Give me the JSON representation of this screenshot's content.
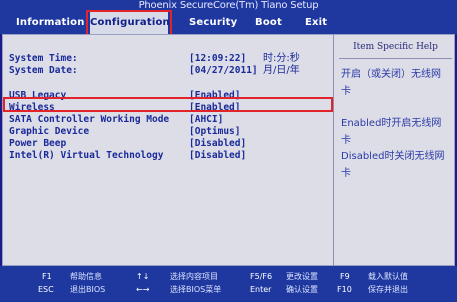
{
  "app_title": "Phoenix SecureCore(Tm) Tiano Setup",
  "menu": [
    {
      "label": "Information"
    },
    {
      "label": "Configuration"
    },
    {
      "label": "Security"
    },
    {
      "label": "Boot"
    },
    {
      "label": "Exit"
    }
  ],
  "settings": [
    {
      "label": "System Time:",
      "value": "[12:09:22]",
      "extra": "时:分:秒"
    },
    {
      "label": "System Date:",
      "value": "[04/27/2011]",
      "extra": "月/日/年"
    },
    {
      "label": "USB Legacy",
      "value": "[Enabled]"
    },
    {
      "label": "Wireless",
      "value": "[Enabled]"
    },
    {
      "label": "SATA Controller Working Mode",
      "value": "[AHCI]"
    },
    {
      "label": "Graphic Device",
      "value": "[Optimus]"
    },
    {
      "label": "Power Beep",
      "value": "[Disabled]"
    },
    {
      "label": "Intel(R) Virtual Technology",
      "value": "[Disabled]"
    }
  ],
  "help": {
    "title": "Item Specific Help",
    "lines": [
      "开启（或关闭）无线网",
      "卡",
      "Enabled时开启无线网",
      "卡",
      "Disabled时关闭无线网",
      "卡"
    ]
  },
  "footer": {
    "f1_key": "F1",
    "f1_desc": "帮助信息",
    "esc_key": "ESC",
    "esc_desc": "退出BIOS",
    "ud_key": "↑↓",
    "ud_desc": "选择内容项目",
    "lr_key": "←→",
    "lr_desc": "选择BIOS菜单",
    "f5f6_key": "F5/F6",
    "f5f6_desc": "更改设置",
    "enter_key": "Enter",
    "enter_desc": "确认设置",
    "f9_key": "F9",
    "f9_desc": "载入默认值",
    "f10_key": "F10",
    "f10_desc": "保存并退出"
  },
  "colors": {
    "background": "#1a1a8c",
    "panel": "#dcdde6",
    "highlight_box": "#e0242a",
    "text": "#1a2a9a"
  }
}
